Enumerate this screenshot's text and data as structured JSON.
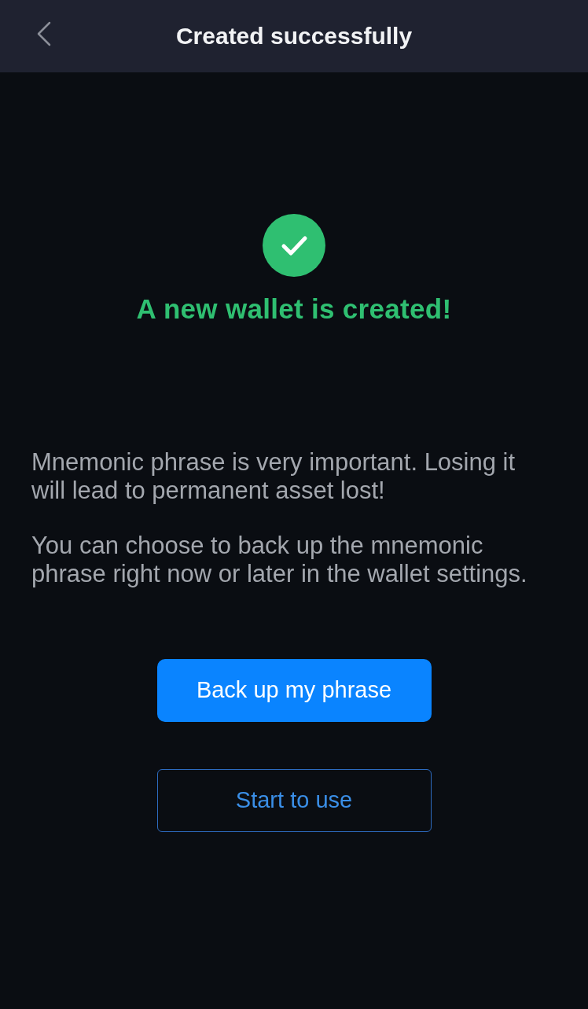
{
  "header": {
    "title": "Created successfully"
  },
  "status": {
    "kind": "success",
    "message": "A new wallet is created!"
  },
  "paragraphs": [
    "Mnemonic phrase is very important. Losing it will lead to permanent asset lost!",
    "You can choose to back up the mnemonic phrase right now or later in the wallet settings."
  ],
  "buttons": [
    {
      "label": "Back up my phrase",
      "kind": "primary"
    },
    {
      "label": "Start to use",
      "kind": "outline"
    }
  ]
}
